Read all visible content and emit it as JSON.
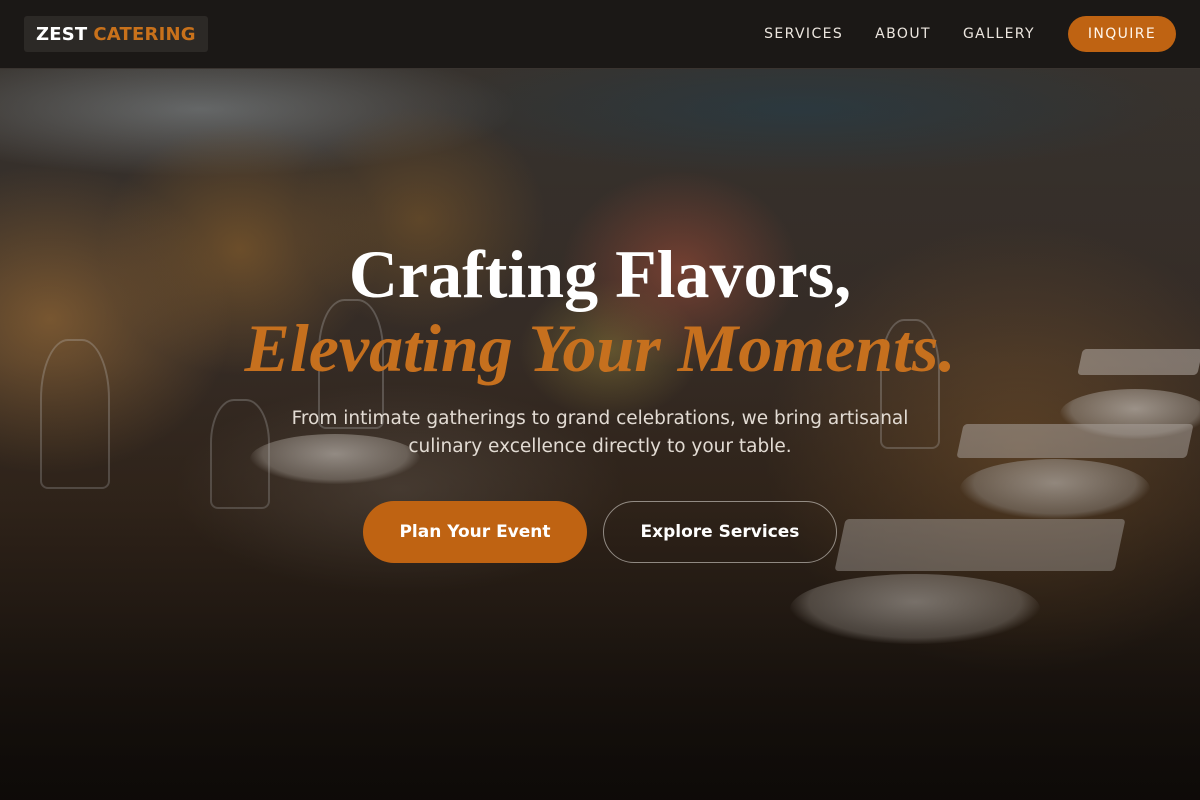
{
  "brand": {
    "name_part1": "ZEST",
    "name_part2": "CATERING",
    "accent_color": "#bf6312"
  },
  "nav": {
    "links": [
      "SERVICES",
      "ABOUT",
      "GALLERY"
    ],
    "cta_label": "INQUIRE"
  },
  "hero": {
    "background": "blurred banquet table with flowers, glassware and plates",
    "headline_line1": "Crafting Flavors,",
    "headline_line2": "Elevating Your Moments.",
    "subtitle": "From intimate gatherings to grand celebrations, we bring artisanal culinary excellence directly to your table.",
    "primary_button": "Plan Your Event",
    "secondary_button": "Explore Services"
  }
}
